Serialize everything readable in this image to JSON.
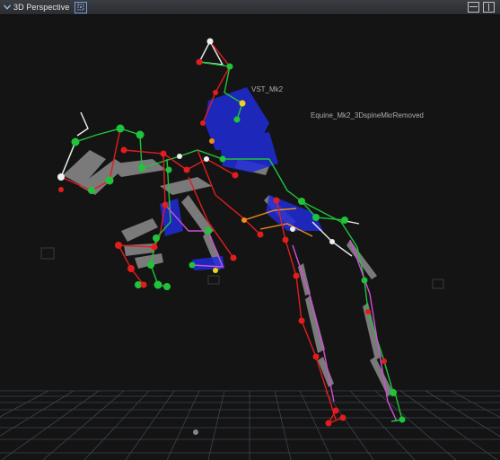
{
  "window": {
    "title": "3D Perspective"
  },
  "viewport": {
    "subject_labels": [
      "VST_Mk2",
      "Equine_Mk2_3DspineMkrRemoved"
    ]
  },
  "colors": {
    "background": "#141414",
    "grid": "#3e4a55",
    "bone_gray": "#8c8c8c",
    "segment_blue": "#1f2bd8",
    "marker_red": "#e21d1d",
    "marker_green": "#1fc43a",
    "link_magenta": "#d14fd6",
    "link_orange": "#f08a1c",
    "link_white": "#f0f0f0"
  },
  "icons": [
    "chevron-down-icon",
    "camera-frame-icon",
    "split-horizontal-icon",
    "split-vertical-icon"
  ]
}
